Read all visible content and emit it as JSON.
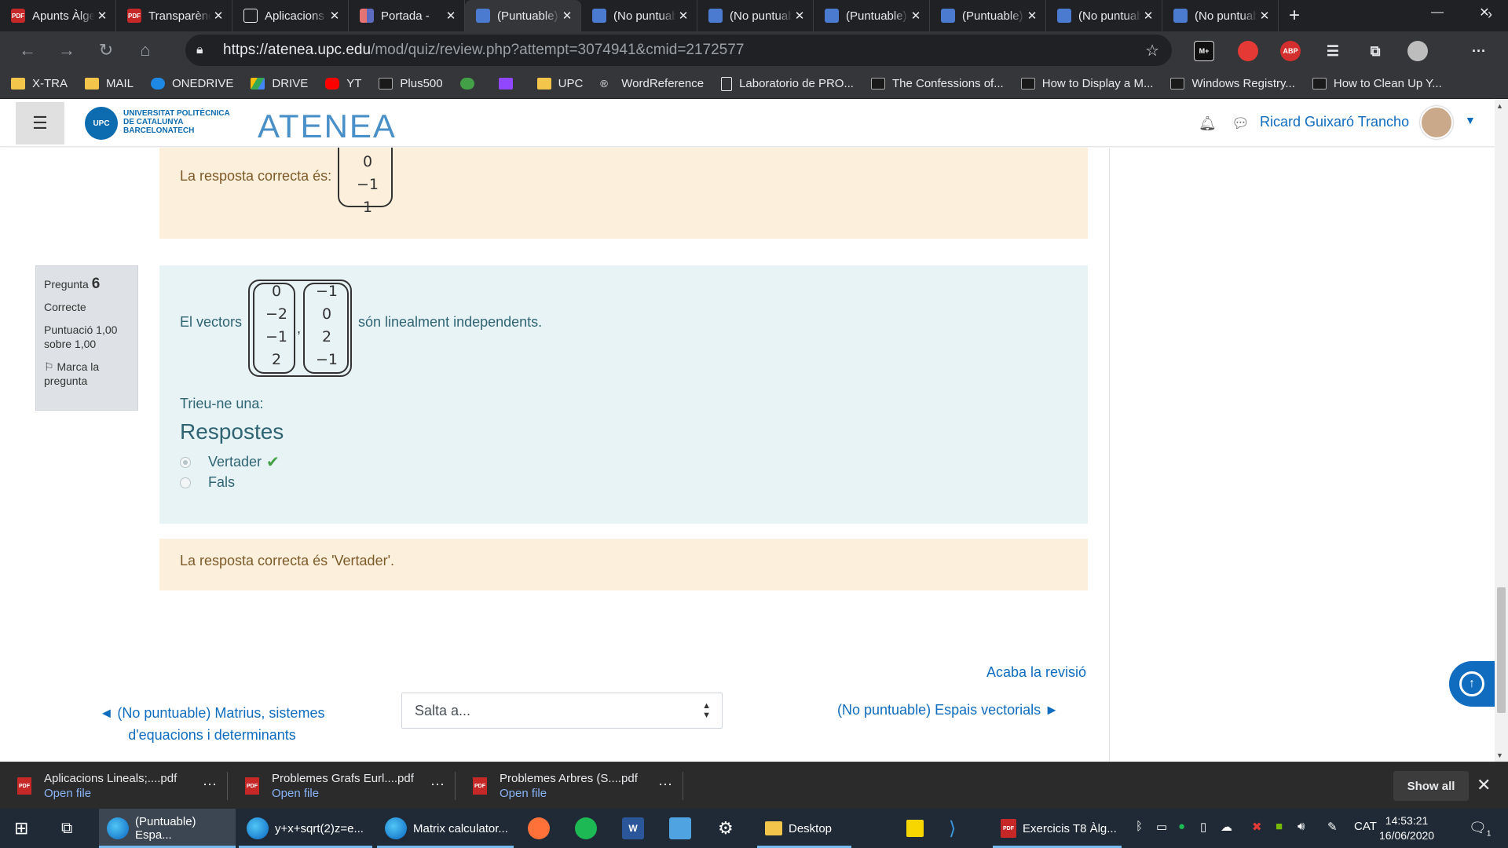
{
  "browser": {
    "tabs": [
      {
        "title": "Apunts Àlgebra",
        "favicon": "pdf",
        "active": false
      },
      {
        "title": "Transparències",
        "favicon": "pdf",
        "active": false
      },
      {
        "title": "Aplicacions",
        "favicon": "doc",
        "active": false
      },
      {
        "title": "Portada - ",
        "favicon": "portada",
        "active": false
      },
      {
        "title": "(Puntuable)",
        "favicon": "moodle",
        "active": true
      },
      {
        "title": "(No puntuable)",
        "favicon": "moodle",
        "active": false
      },
      {
        "title": "(No puntuable)",
        "favicon": "moodle",
        "active": false
      },
      {
        "title": "(Puntuable)",
        "favicon": "moodle",
        "active": false
      },
      {
        "title": "(Puntuable)",
        "favicon": "moodle",
        "active": false
      },
      {
        "title": "(No puntuable)",
        "favicon": "moodle",
        "active": false
      },
      {
        "title": "(No puntuable)",
        "favicon": "moodle",
        "active": false
      }
    ],
    "tab_close": "✕",
    "new_tab": "+",
    "url_host": "https://atenea.upc.edu",
    "url_path": "/mod/quiz/review.php?attempt=3074941&cmid=2172577",
    "extensions": [
      "M+",
      "ABP"
    ],
    "bookmarks": [
      {
        "label": "X-TRA",
        "icon": "folder"
      },
      {
        "label": "MAIL",
        "icon": "folder"
      },
      {
        "label": "ONEDRIVE",
        "icon": "cloud"
      },
      {
        "label": "DRIVE",
        "icon": "drive"
      },
      {
        "label": "YT",
        "icon": "yt"
      },
      {
        "label": "Plus500",
        "icon": "sq"
      },
      {
        "label": "",
        "icon": "green"
      },
      {
        "label": "",
        "icon": "twitch"
      },
      {
        "label": "UPC",
        "icon": "folder"
      },
      {
        "label": "WordReference",
        "icon": "wr"
      },
      {
        "label": "Laboratorio de PRO...",
        "icon": "page"
      },
      {
        "label": "The Confessions of...",
        "icon": "sq"
      },
      {
        "label": "How to Display a M...",
        "icon": "sq"
      },
      {
        "label": "Windows Registry...",
        "icon": "sq"
      },
      {
        "label": "How to Clean Up Y...",
        "icon": "sq"
      }
    ]
  },
  "header": {
    "university": [
      "UNIVERSITAT POLITÈCNICA",
      "DE CATALUNYA",
      "BARCELONATECH"
    ],
    "logo_abbr": "UPC",
    "site_name": "ATENEA",
    "user_name": "Ricard Guixaró Trancho"
  },
  "previous_feedback": {
    "label": "La resposta correcta és:",
    "vector": [
      "0",
      "−1",
      "1"
    ]
  },
  "question": {
    "number_prefix": "Pregunta",
    "number": "6",
    "state": "Correcte",
    "grade": "Puntuació 1,00 sobre 1,00",
    "flag": "Marca la pregunta",
    "stem_before": "El vectors",
    "stem_after": "són linealment independents.",
    "vector1": [
      "0",
      "−2",
      "−1",
      "2"
    ],
    "vector2": [
      "−1",
      "0",
      "2",
      "−1"
    ],
    "choose_one": "Trieu-ne una:",
    "answers_heading": "Respostes",
    "answers": [
      {
        "label": "Vertader",
        "selected": true,
        "correct": true
      },
      {
        "label": "Fals",
        "selected": false,
        "correct": false
      }
    ],
    "feedback": "La resposta correcta és 'Vertader'."
  },
  "navigation": {
    "finish_review": "Acaba la revisió",
    "previous": "◄ (No puntuable) Matrius, sistemes d'equacions i determinants",
    "jump_placeholder": "Salta a...",
    "next": "(No puntuable) Espais vectorials ►"
  },
  "downloads": {
    "items": [
      {
        "name": "Aplicacions Lineals;....pdf",
        "action": "Open file"
      },
      {
        "name": "Problemes Grafs Eurl....pdf",
        "action": "Open file"
      },
      {
        "name": "Problemes Arbres (S....pdf",
        "action": "Open file"
      }
    ],
    "show_all": "Show all"
  },
  "taskbar": {
    "apps": [
      {
        "label": "(Puntuable) Espa...",
        "active": true
      },
      {
        "label": "y+x+sqrt(2)z=e...",
        "active": false
      },
      {
        "label": "Matrix calculator...",
        "active": false
      },
      {
        "label": "Desktop",
        "active": false
      },
      {
        "label": "Exercicis T8 Àlg...",
        "active": false
      }
    ],
    "language": "CAT",
    "time": "14:53:21",
    "date": "16/06/2020",
    "notifications": "1"
  },
  "colors": {
    "link": "#0f6cbf",
    "question_bg": "#e7f3f5",
    "feedback_bg": "#fcefdc",
    "correct_check": "#43a047",
    "browser_dark": "#202124"
  }
}
